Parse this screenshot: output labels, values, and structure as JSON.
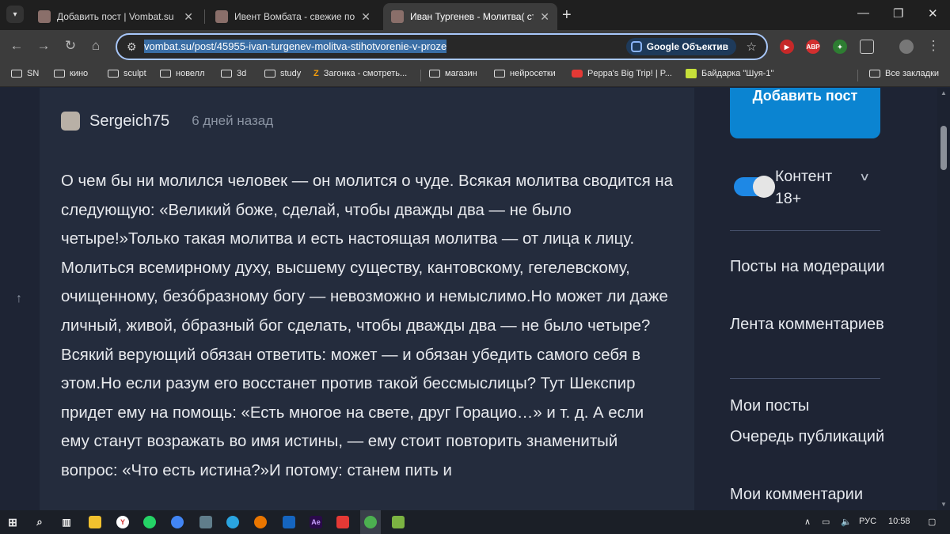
{
  "browser": {
    "tabs": [
      {
        "title": "Добавить пост | Vombat.su",
        "active": false
      },
      {
        "title": "Ивент Вомбата - свежие посты",
        "active": false
      },
      {
        "title": "Иван Тургенев - Молитва( сти",
        "active": true
      }
    ],
    "url": "vombat.su/post/45955-ivan-turgenev-molitva-stihotvorenie-v-proze",
    "lens_label": "Google Объектив",
    "bookmarks": [
      "SN",
      "кино",
      "sculpt",
      "новелл",
      "3d",
      "study",
      "Загонка - смотреть...",
      "магазин",
      "нейросетки",
      "Peppa's Big Trip! | P...",
      "Байдарка \"Шуя-1\""
    ],
    "all_bookmarks": "Все закладки"
  },
  "post": {
    "author": "Sergeich75",
    "time": "6 дней назад",
    "text": "О чем бы ни молился человек — он молится о чуде. Всякая молитва сводится на следующую: «Великий боже, сделай, чтобы дважды два — не было четыре!»Только такая молитва и есть настоящая молитва — от лица к лицу. Молиться всемирному духу, высшему существу, кантовскому, гегелевскому, очищенному, безóбразному богу — невозможно и немыслимо.Но может ли даже личный, живой, óбразный бог сделать, чтобы дважды два — не было четыре? Всякий верующий обязан ответить: может — и обязан убедить самого себя в этом.Но если разум его восстанет против такой бессмыслицы? Тут Шекспир придет ему на помощь: «Есть многое на свете, друг Горацио…» и т. д. А если ему станут возражать во имя истины, — ему стоит повторить знаменитый вопрос: «Что есть истина?»И потому: станем пить и"
  },
  "sidebar": {
    "add_post": "Добавить пост",
    "content_toggle": "Контент 18+",
    "content_toggle_on": true,
    "links_group1": [
      "Посты на модерации",
      "Лента комментариев"
    ],
    "links_group2": [
      "Мои посты",
      "Очередь публикаций",
      "Мои комментарии"
    ]
  },
  "taskbar": {
    "language": "РУС",
    "clock": "10:58"
  },
  "colors": {
    "page_bg": "#1e2434",
    "card_bg": "#242c3d",
    "accent": "#0b84d1",
    "toggle": "#1e88e5"
  }
}
